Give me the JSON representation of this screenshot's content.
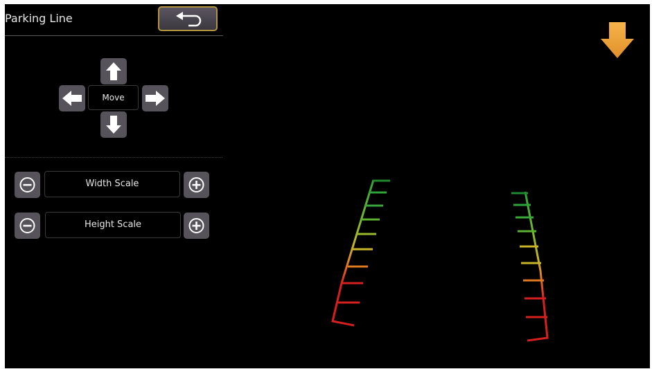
{
  "header": {
    "title": "Parking Line",
    "back_icon": "return-arrow-icon"
  },
  "move_pad": {
    "label": "Move",
    "buttons": [
      "up-arrow-icon",
      "left-arrow-icon",
      "right-arrow-icon",
      "down-arrow-icon"
    ]
  },
  "scales": [
    {
      "label": "Width Scale",
      "decrease_icon": "minus-circle-icon",
      "increase_icon": "plus-circle-icon"
    },
    {
      "label": "Height Scale",
      "decrease_icon": "minus-circle-icon",
      "increase_icon": "plus-circle-icon"
    }
  ],
  "indicator": {
    "icon": "down-arrow-icon",
    "color": "#f0a63c"
  },
  "guide_colors": {
    "near": "#d81f1f",
    "mid_near": "#e07a20",
    "mid": "#c8b428",
    "mid_far": "#7bb82c",
    "far": "#2ea33a"
  }
}
